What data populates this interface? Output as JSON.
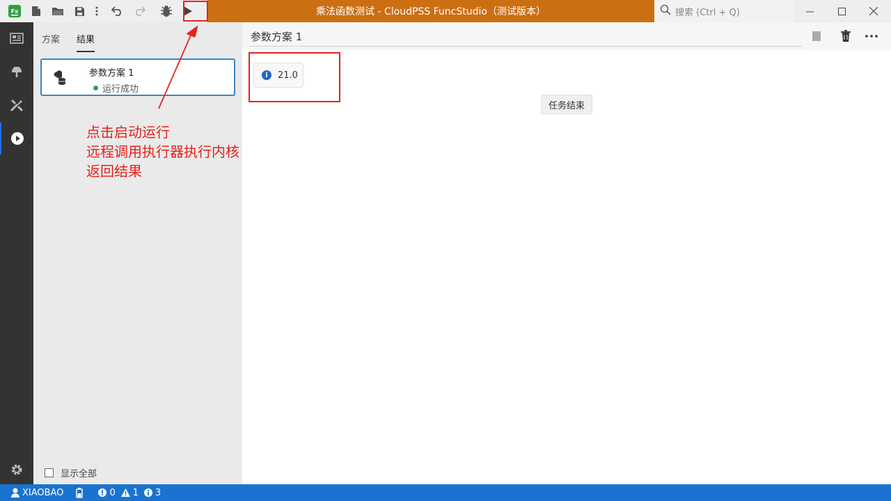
{
  "window": {
    "title": "乘法函数测试 - CloudPSS FuncStudio（测试版本）",
    "accent": "#cc6f13"
  },
  "search": {
    "placeholder": "搜索 (Ctrl + Q)"
  },
  "toolbar": {
    "icons": [
      "app-logo-icon",
      "new-file-icon",
      "open-folder-icon",
      "save-icon",
      "more-vert-icon",
      "undo-icon",
      "redo-icon",
      "debug-icon",
      "run-icon"
    ],
    "logo_text": "Fx"
  },
  "activity_bar": {
    "items": [
      "overview-icon",
      "plugin-icon",
      "tools-icon",
      "run-results-icon",
      "settings-icon"
    ],
    "active": "run-results-icon"
  },
  "side_panel": {
    "tabs": [
      {
        "label": "方案"
      },
      {
        "label": "结果"
      }
    ],
    "active_tab": "结果",
    "card": {
      "title": "参数方案 1",
      "status": "运行成功",
      "status_color": "#2e9e6b"
    },
    "show_all_label": "显示全部"
  },
  "annotation": {
    "lines": [
      "点击启动运行",
      "远程调用执行器执行内核",
      "返回结果"
    ],
    "color": "#e5231b"
  },
  "main": {
    "title": "参数方案 1",
    "result_value": "21.0",
    "task_end_label": "任务结束"
  },
  "statusbar": {
    "user": "XIAOBAO",
    "errors": "0",
    "warnings": "1",
    "infos": "3",
    "color": "#1a73d0"
  }
}
